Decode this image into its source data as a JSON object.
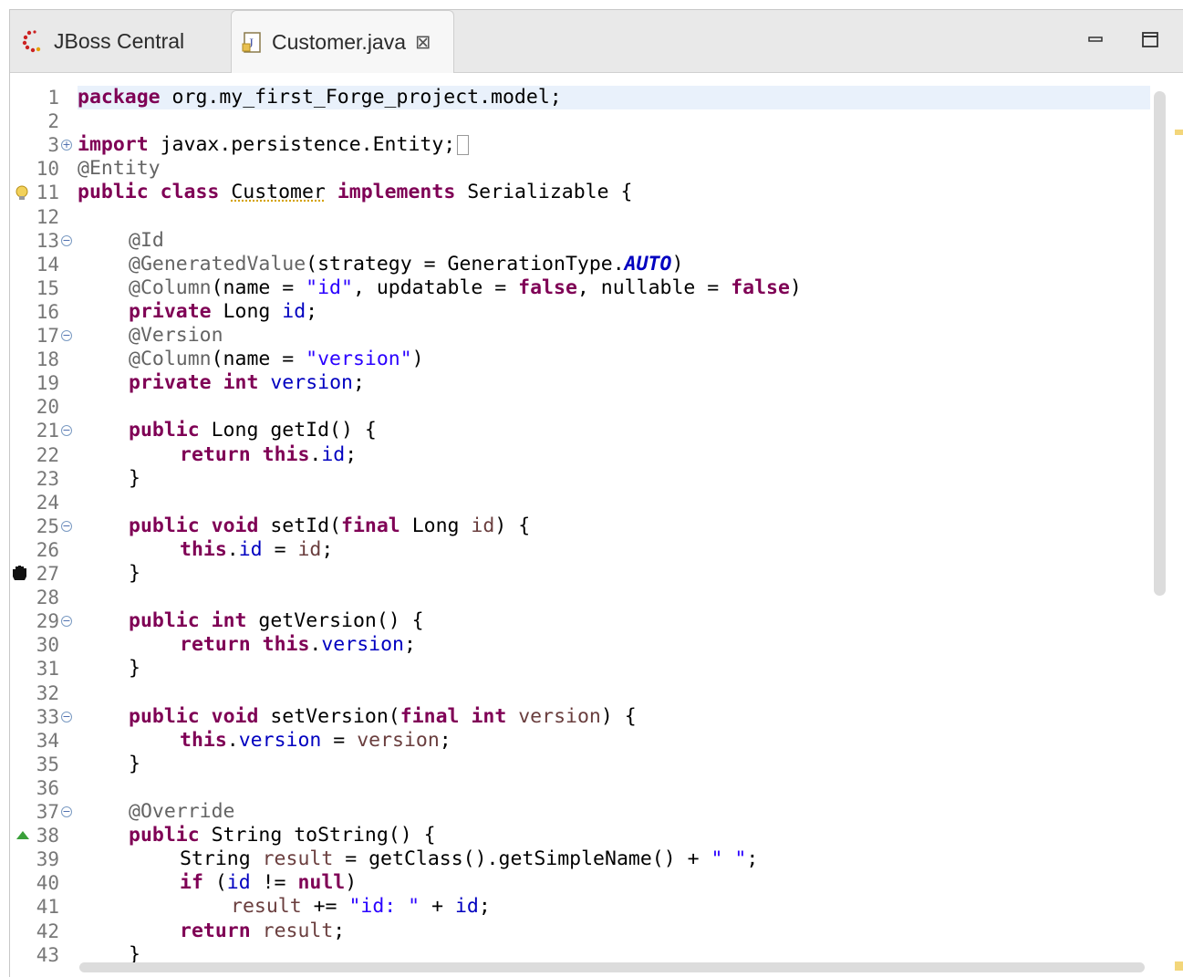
{
  "tabs": [
    {
      "label": "JBoss Central",
      "icon": "jboss-central-icon",
      "active": false
    },
    {
      "label": "Customer.java",
      "icon": "java-file-icon",
      "active": true,
      "close_glyph": "⊠"
    }
  ],
  "window_controls": [
    "minimize-icon",
    "maximize-icon"
  ],
  "editor": {
    "line_numbers": [
      "1",
      "2",
      "3",
      "10",
      "11",
      "12",
      "13",
      "14",
      "15",
      "16",
      "17",
      "18",
      "19",
      "20",
      "21",
      "22",
      "23",
      "24",
      "25",
      "26",
      "27",
      "28",
      "29",
      "30",
      "31",
      "32",
      "33",
      "34",
      "35",
      "36",
      "37",
      "38",
      "39",
      "40",
      "41",
      "42",
      "43"
    ]
  },
  "code_lines": {
    "l1": {
      "kw": "package",
      "rest": " org.my_first_Forge_project.model;"
    },
    "l3": {
      "kw": "import",
      "rest": " javax.persistence.Entity;"
    },
    "l10": {
      "ann": "@Entity"
    },
    "l11": {
      "kw1": "public",
      "kw2": "class",
      "name": "Customer",
      "kw3": "implements",
      "rest": " Serializable {"
    },
    "l13": {
      "ann": "@Id"
    },
    "l14": {
      "ann": "@GeneratedValue",
      "p1": "(strategy = GenerationType.",
      "const": "AUTO",
      "p2": ")"
    },
    "l15": {
      "ann": "@Column",
      "p1": "(name = ",
      "str": "\"id\"",
      "p2": ", updatable = ",
      "kw1": "false",
      "p3": ", nullable = ",
      "kw2": "false",
      "p4": ")"
    },
    "l16": {
      "kw": "private",
      "p1": " Long ",
      "fld": "id",
      "p2": ";"
    },
    "l17": {
      "ann": "@Version"
    },
    "l18": {
      "ann": "@Column",
      "p1": "(name = ",
      "str": "\"version\"",
      "p2": ")"
    },
    "l19": {
      "kw1": "private",
      "kw2": "int",
      "fld": "version",
      "p2": ";"
    },
    "l21": {
      "kw": "public",
      "p1": " Long getId() {"
    },
    "l22": {
      "kw1": "return",
      "kw2": "this",
      "dot": ".",
      "fld": "id",
      "p2": ";"
    },
    "l23": {
      "p1": "}"
    },
    "l25": {
      "kw1": "public",
      "kw2": "void",
      "p1": " setId(",
      "kw3": "final",
      "p2": " Long ",
      "var": "id",
      "p3": ") {"
    },
    "l26": {
      "kw": "this",
      "dot": ".",
      "fld": "id",
      "p1": " = ",
      "var": "id",
      "p2": ";"
    },
    "l27": {
      "p1": "}"
    },
    "l29": {
      "kw1": "public",
      "kw2": "int",
      "p1": " getVersion() {"
    },
    "l30": {
      "kw1": "return",
      "kw2": "this",
      "dot": ".",
      "fld": "version",
      "p2": ";"
    },
    "l31": {
      "p1": "}"
    },
    "l33": {
      "kw1": "public",
      "kw2": "void",
      "p1": " setVersion(",
      "kw3": "final",
      "kw4": "int",
      "var": "version",
      "p3": ") {"
    },
    "l34": {
      "kw": "this",
      "dot": ".",
      "fld": "version",
      "p1": " = ",
      "var": "version",
      "p2": ";"
    },
    "l35": {
      "p1": "}"
    },
    "l37": {
      "ann": "@Override"
    },
    "l38": {
      "kw": "public",
      "p1": " String toString() {"
    },
    "l39": {
      "p1": "String ",
      "var": "result",
      "p2": " = getClass().getSimpleName() + ",
      "str": "\" \"",
      "p3": ";"
    },
    "l40": {
      "kw1": "if",
      "p1": " (",
      "fld": "id",
      "p2": " != ",
      "kw2": "null",
      "p3": ")"
    },
    "l41": {
      "var": "result",
      "p1": " += ",
      "str": "\"id: \"",
      "p2": " + ",
      "fld": "id",
      "p3": ";"
    },
    "l42": {
      "kw": "return",
      "var": "result",
      "p1": ";"
    },
    "l43": {
      "p1": "}"
    }
  }
}
